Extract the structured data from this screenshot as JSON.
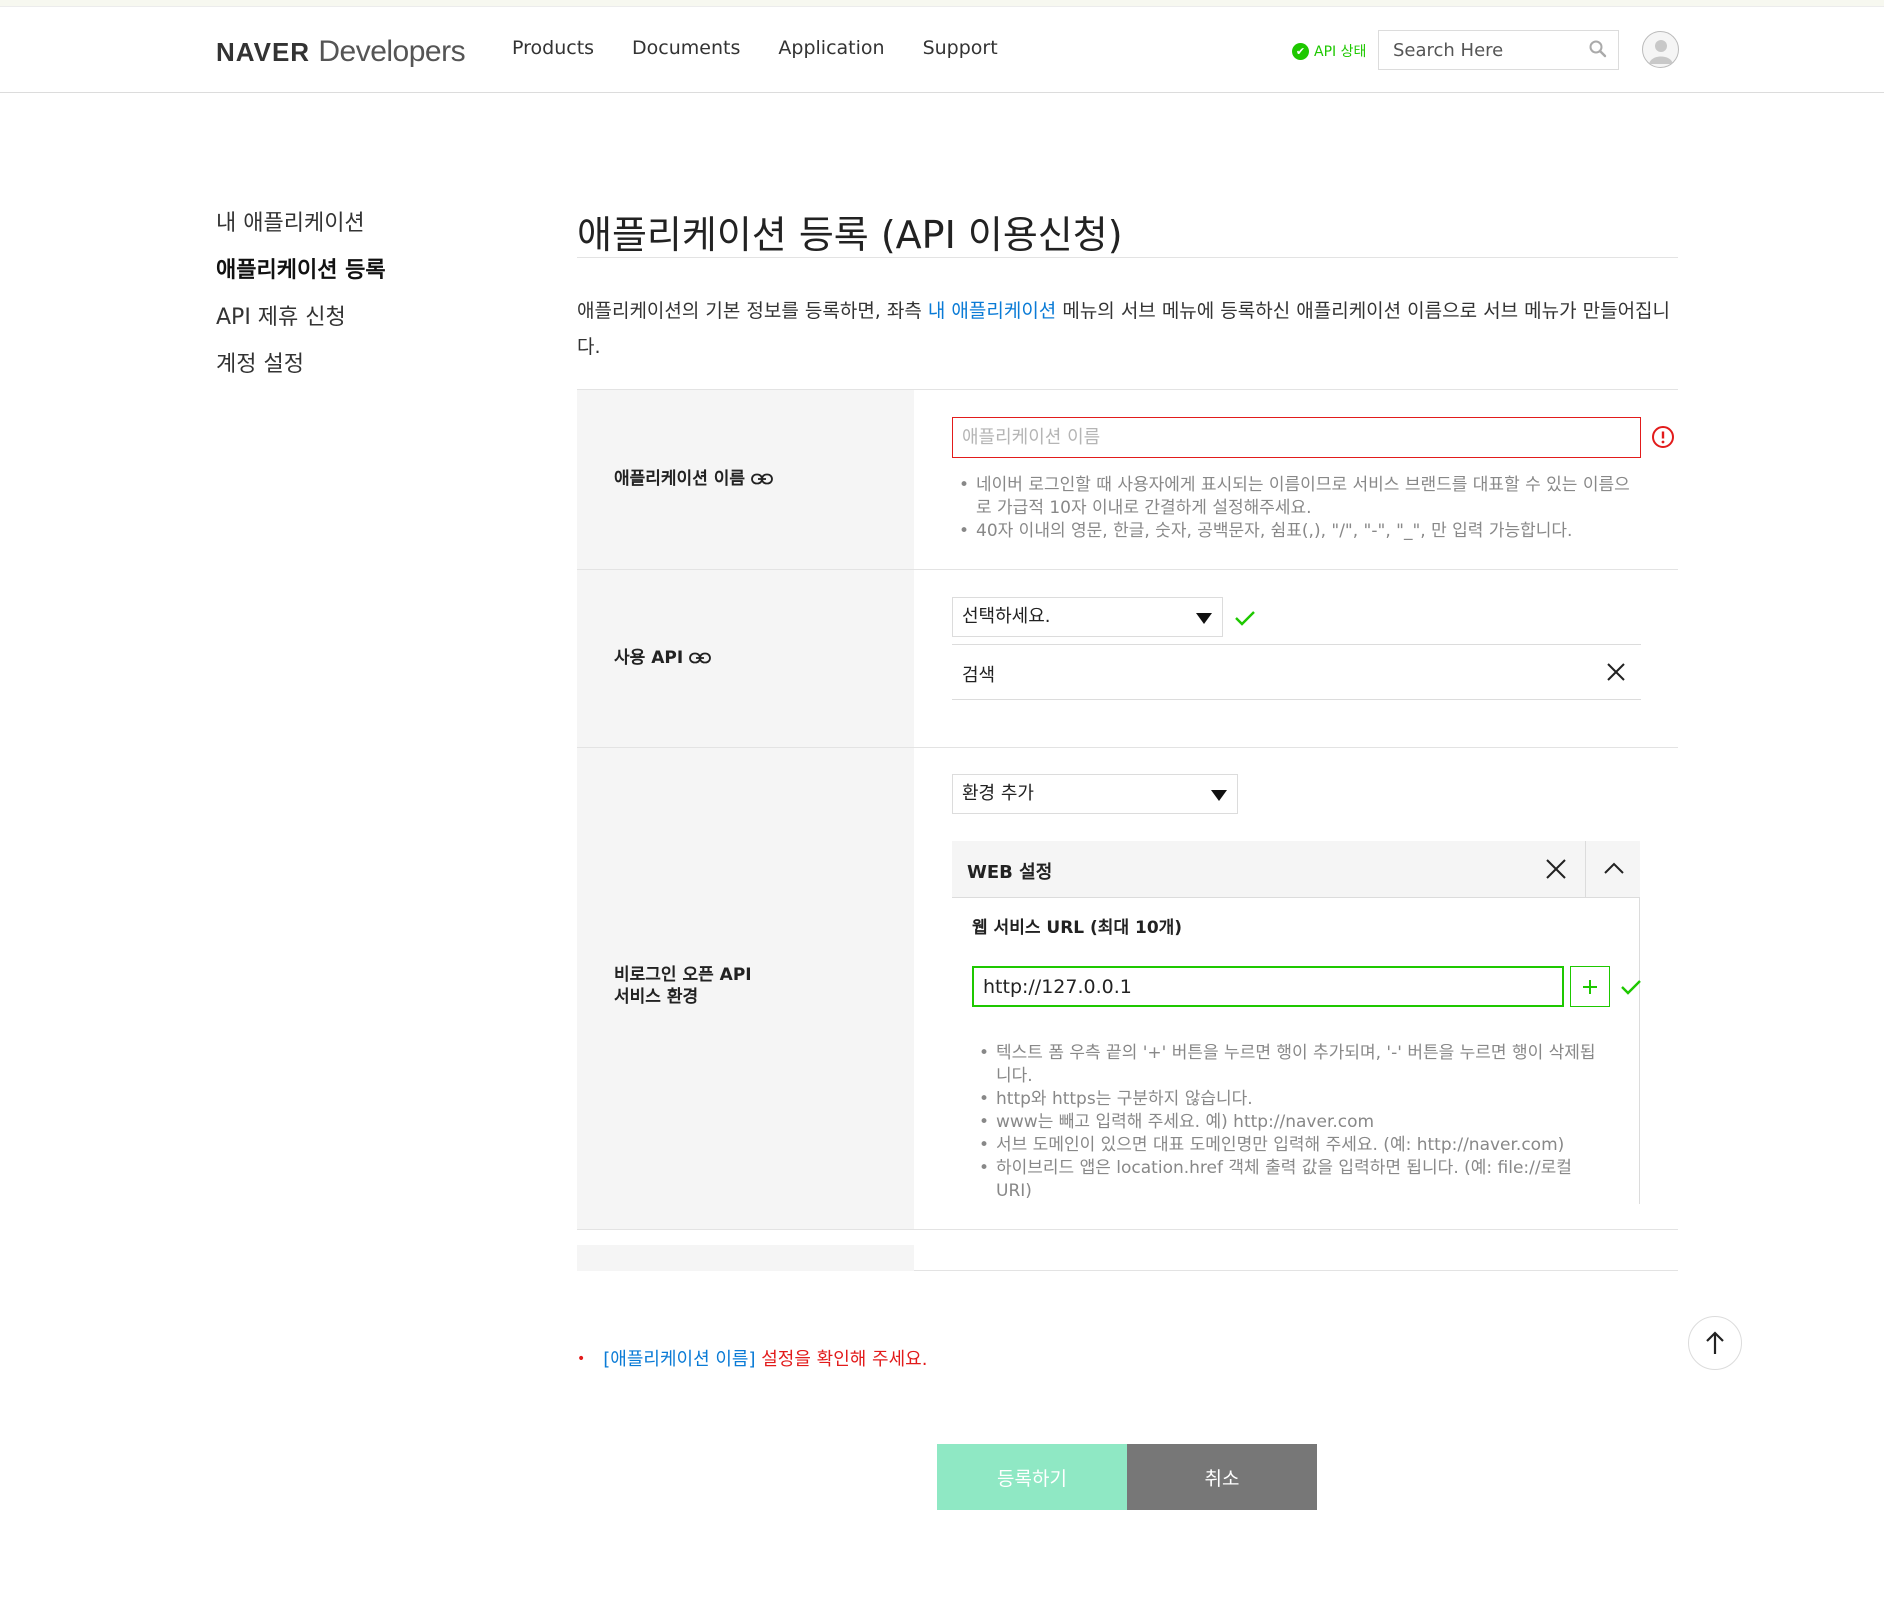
{
  "header": {
    "logo_naver": "NAVER",
    "logo_developers": "Developers",
    "nav": [
      "Products",
      "Documents",
      "Application",
      "Support"
    ],
    "api_status": "API 상태",
    "search_placeholder": "Search Here"
  },
  "sidebar": {
    "items": [
      {
        "label": "내 애플리케이션",
        "active": false
      },
      {
        "label": "애플리케이션 등록",
        "active": true
      },
      {
        "label": "API 제휴 신청",
        "active": false
      },
      {
        "label": "계정 설정",
        "active": false
      }
    ]
  },
  "main": {
    "title": "애플리케이션 등록 (API 이용신청)",
    "desc_pre": "애플리케이션의 기본 정보를 등록하면, 좌측 ",
    "desc_link": "내 애플리케이션",
    "desc_post": " 메뉴의 서브 메뉴에 등록하신 애플리케이션 이름으로 서브 메뉴가 만들어집니다."
  },
  "form": {
    "app_name": {
      "label": "애플리케이션 이름",
      "placeholder": "애플리케이션 이름",
      "hints": [
        "네이버 로그인할 때 사용자에게 표시되는 이름이므로 서비스 브랜드를 대표할 수 있는 이름으로 가급적 10자 이내로 간결하게 설정해주세요.",
        "40자 이내의 영문, 한글, 숫자, 공백문자, 쉼표(,), \"/\", \"-\", \"_\", 만 입력 가능합니다."
      ]
    },
    "api": {
      "label": "사용 API",
      "select_value": "선택하세요.",
      "selected_item": "검색"
    },
    "env": {
      "label_line1": "비로그인 오픈 API",
      "label_line2": "서비스 환경",
      "select_value": "환경 추가",
      "panel_title": "WEB 설정",
      "sub_title": "웹 서비스 URL (최대 10개)",
      "url_value": "http://127.0.0.1",
      "hints": [
        "텍스트 폼 우측 끝의 '+' 버튼을 누르면 행이 추가되며, '-' 버튼을 누르면 행이 삭제됩니다.",
        "http와 https는 구분하지 않습니다.",
        "www는 빼고 입력해 주세요. 예) http://naver.com",
        "서브 도메인이 있으면 대표 도메인명만 입력해 주세요. (예: http://naver.com)",
        "하이브리드 앱은 location.href 객체 출력 값을 입력하면 됩니다. (예: file://로컬URI)"
      ]
    }
  },
  "error": {
    "bullet": "•",
    "key": "[애플리케이션 이름]",
    "message": " 설정을 확인해 주세요."
  },
  "buttons": {
    "register": "등록하기",
    "cancel": "취소"
  },
  "colors": {
    "brand_green": "#1ec800",
    "error_red": "#e21b1b",
    "link_blue": "#0a7bd6",
    "register_bg": "#8fe8c4",
    "cancel_bg": "#777777"
  }
}
